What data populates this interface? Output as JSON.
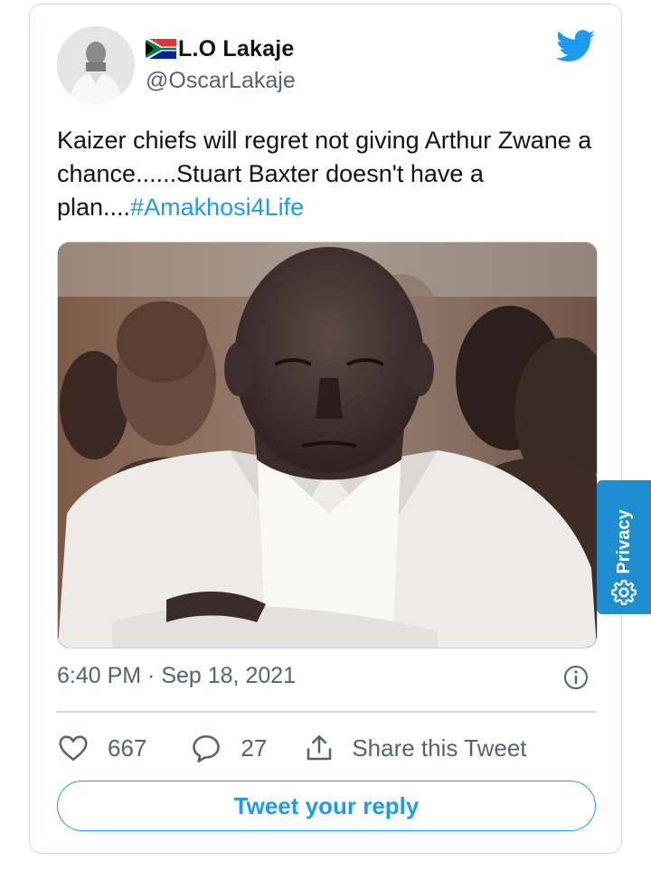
{
  "tweet": {
    "display_name": "L.O Lakaje",
    "handle": "@OscarLakaje",
    "text_main": "Kaizer chiefs will regret not giving Arthur Zwane a chance......Stuart Baxter doesn't have a plan....",
    "hashtag": "#Amakhosi4Life",
    "timestamp": "6:40 PM · Sep 18, 2021",
    "likes": "667",
    "replies": "27",
    "share_label": "Share this Tweet",
    "reply_button_label": "Tweet your reply"
  },
  "privacy_tab": {
    "label": "Privacy"
  },
  "icons": {
    "flag": "south-africa-flag-icon",
    "brand": "twitter-bird-icon",
    "info": "info-icon",
    "like": "heart-icon",
    "reply": "speech-bubble-icon",
    "share": "share-upload-icon",
    "privacy": "gear-icon"
  },
  "colors": {
    "accent": "#1d9bf0",
    "text_primary": "#0f1419",
    "text_secondary": "#536471",
    "border": "#cfd9de",
    "privacy_tab": "#1f8ed1"
  }
}
